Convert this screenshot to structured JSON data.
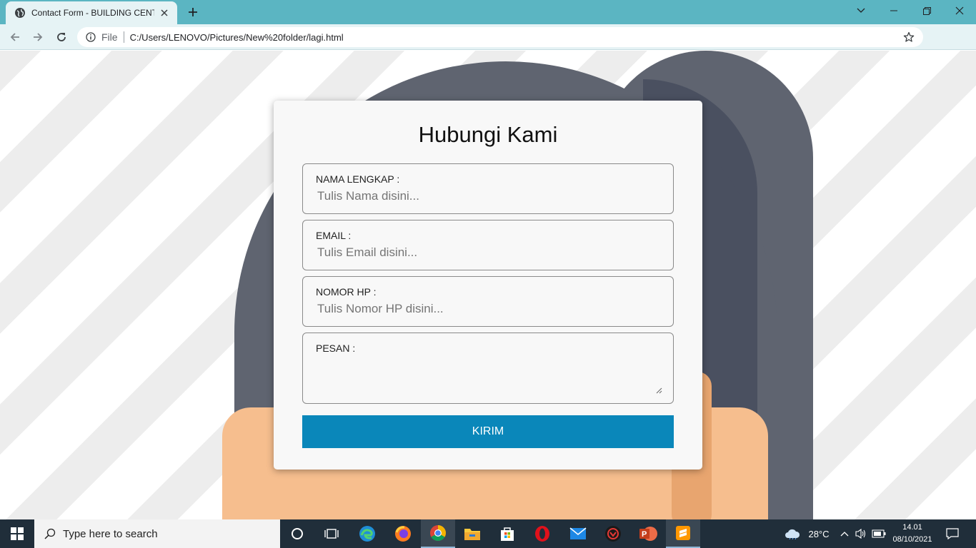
{
  "browser": {
    "tab_title": "Contact Form - BUILDING CENTE",
    "scheme_label": "File",
    "url": "C:/Users/LENOVO/Pictures/New%20folder/lagi.html"
  },
  "form": {
    "title": "Hubungi Kami",
    "fields": [
      {
        "label": "NAMA LENGKAP :",
        "placeholder": "Tulis Nama disini..."
      },
      {
        "label": "EMAIL :",
        "placeholder": "Tulis Email disini..."
      },
      {
        "label": "NOMOR HP :",
        "placeholder": "Tulis Nomor HP disini..."
      },
      {
        "label": "PESAN :",
        "placeholder": ""
      }
    ],
    "submit_label": "KIRIM"
  },
  "taskbar": {
    "search_placeholder": "Type here to search",
    "weather_temp": "28°C",
    "time": "14.01",
    "date": "08/10/2021",
    "apps": [
      "task-view",
      "edge",
      "firefox",
      "chrome",
      "file-explorer",
      "microsoft-store",
      "opera",
      "game-app",
      "powerpoint",
      "sublime-text"
    ]
  },
  "colors": {
    "titlebar": "#5bb5c2",
    "submit_button": "#0a87ba",
    "taskbar": "#202e3a"
  }
}
